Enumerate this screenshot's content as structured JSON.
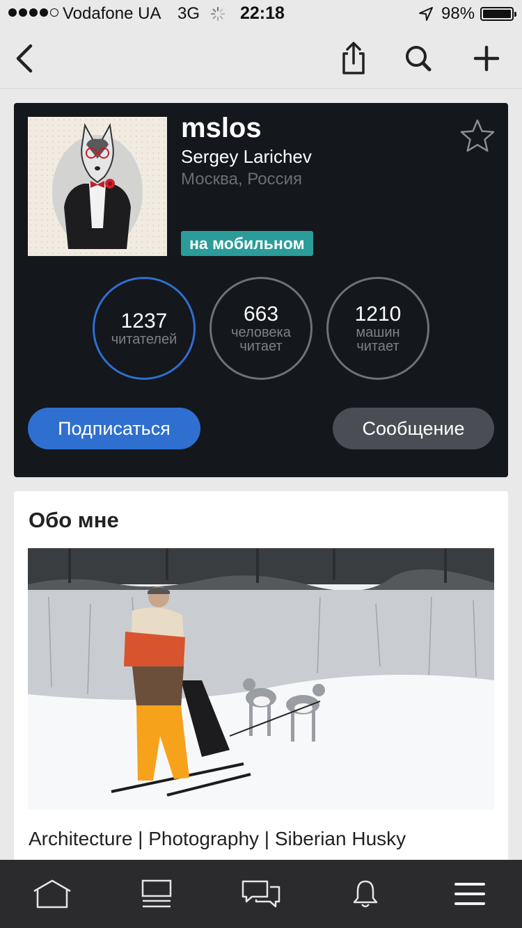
{
  "status_bar": {
    "carrier": "Vodafone UA",
    "network": "3G",
    "time": "22:18",
    "battery": "98%",
    "battery_level": 0.98
  },
  "navbar": {
    "icons": [
      "back-icon",
      "share-icon",
      "search-icon",
      "plus-icon"
    ]
  },
  "profile": {
    "username": "mslos",
    "full_name": "Sergey Larichev",
    "location": "Москва, Россия",
    "badge": "на мобильном",
    "stats": [
      {
        "value": "1237",
        "label": "читателей"
      },
      {
        "value": "663",
        "label": "человека\nчитает"
      },
      {
        "value": "1210",
        "label": "машин\nчитает"
      }
    ],
    "subscribe_label": "Подписаться",
    "message_label": "Сообщение"
  },
  "about": {
    "title": "Обо мне",
    "tags": "Architecture | Photography | Siberian Husky"
  },
  "tabbar": {
    "icons": [
      "home-icon",
      "feed-icon",
      "messages-icon",
      "bell-icon",
      "menu-icon"
    ]
  },
  "colors": {
    "accent": "#2f6fd0",
    "badge": "#2a9c9a",
    "card_dark": "#14171c",
    "tabbar": "#2b2b2d"
  }
}
